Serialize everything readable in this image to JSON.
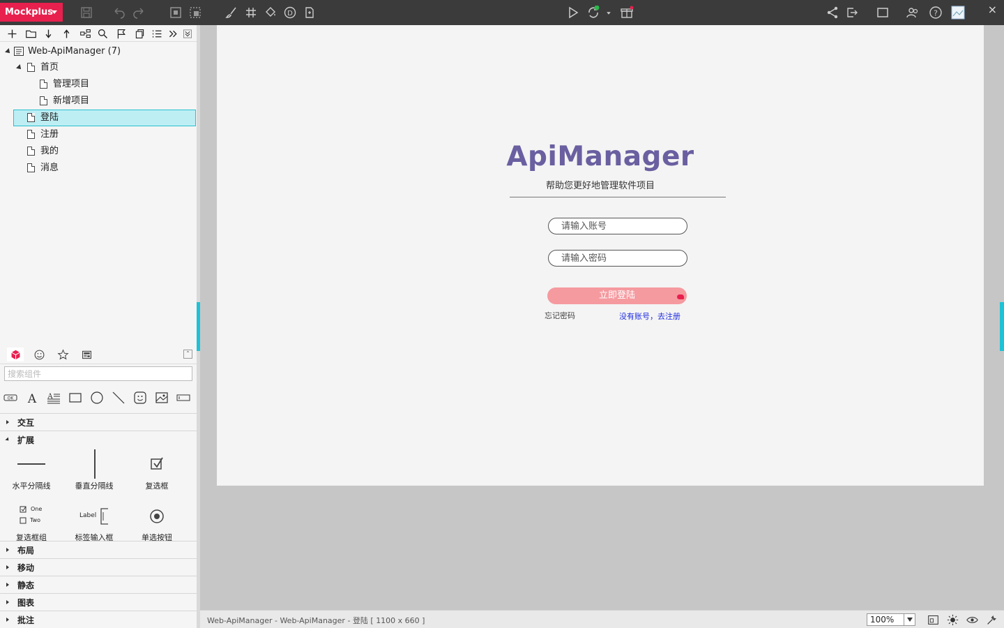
{
  "app": {
    "brand": "Mockplus"
  },
  "toolbar": {
    "icons": [
      "save-icon",
      "undo-icon",
      "redo-icon",
      "frame-icon",
      "frame-alt-icon",
      "brush-icon",
      "grid-icon",
      "paint-bucket-icon",
      "d-circle-icon",
      "export-page-icon",
      "play-icon",
      "sync-icon",
      "gift-icon",
      "share-icon",
      "export-icon",
      "fullscreen-icon",
      "users-icon",
      "help-icon",
      "thumbnail-icon",
      "close-icon"
    ],
    "close": "×"
  },
  "tree": {
    "toolbar_icons": [
      "add-icon",
      "folder-icon",
      "arrow-down-icon",
      "arrow-up-icon",
      "hierarchy-icon",
      "search-icon",
      "flag-icon",
      "copy-icon",
      "list-icon",
      "more-icon",
      "collapse-icon"
    ],
    "root": "Web-ApiManager (7)",
    "pages": [
      {
        "label": "首页",
        "level": 1
      },
      {
        "label": "管理项目",
        "level": 2
      },
      {
        "label": "新增项目",
        "level": 2
      },
      {
        "label": "登陆",
        "level": 1,
        "selected": true
      },
      {
        "label": "注册",
        "level": 1
      },
      {
        "label": "我的",
        "level": 1
      },
      {
        "label": "消息",
        "level": 1
      }
    ]
  },
  "components": {
    "tabs": [
      "cube-icon",
      "emoji-icon",
      "star-icon",
      "template-icon"
    ],
    "search_placeholder": "搜索组件",
    "quick_icons": [
      "ok-button-icon",
      "text-icon",
      "paragraph-icon",
      "rectangle-icon",
      "circle-icon",
      "line-icon",
      "smiley-icon",
      "image-icon",
      "input-icon"
    ],
    "sections": {
      "interaction": "交互",
      "extension": "扩展",
      "layout": "布局",
      "mobile": "移动",
      "static": "静态",
      "chart": "图表",
      "annotation": "批注"
    },
    "widgets": {
      "hline": "水平分隔线",
      "vline": "垂直分隔线",
      "checkbox": "复选框",
      "checkbox_group": "复选框组",
      "checkbox_group_one": "One",
      "checkbox_group_two": "Two",
      "label_input": "标签输入框",
      "label_input_label": "Label",
      "radio": "单选按钮"
    }
  },
  "canvas": {
    "title": "ApiManager",
    "subtitle": "帮助您更好地管理软件项目",
    "account_placeholder": "请输入账号",
    "password_placeholder": "请输入密码",
    "login_button": "立即登陆",
    "forgot": "忘记密码",
    "register": "没有账号，去注册"
  },
  "colors": {
    "brand": "#e8204e",
    "accent": "#1ec2d6",
    "title": "#6a5fa0",
    "login_button": "#f59a9f",
    "register_link": "#1f2de0"
  },
  "statusbar": {
    "path": "Web-ApiManager - Web-ApiManager - 登陆 [ 1100 x 660 ]",
    "zoom": "100%"
  }
}
